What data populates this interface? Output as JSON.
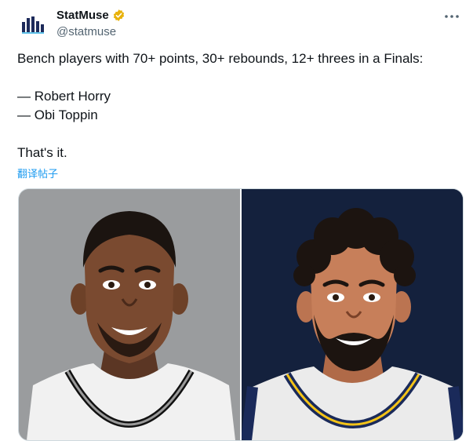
{
  "account": {
    "display_name": "StatMuse",
    "handle": "@statmuse",
    "avatar_icon": "statmuse-logo-icon",
    "verified_icon": "verified-badge-icon",
    "brand_color": "#1d2a5a",
    "verified_color": "#e8b20b"
  },
  "menu": {
    "icon": "more-horizontal-icon"
  },
  "tweet": {
    "line1": "Bench players with 70+ points, 30+ rebounds, 12+ threes in a Finals:",
    "line2": "— Robert Horry",
    "line3": "— Obi Toppin",
    "line4": "That's it.",
    "translate_label": "翻译帖子"
  },
  "media": {
    "left_player": {
      "background": "#9a9c9e",
      "jersey": "#f1f1f1",
      "trim": "#111111"
    },
    "right_player": {
      "background": "#14213d",
      "jersey": "#ebebeb",
      "trim": "#f3c318"
    }
  },
  "colors": {
    "link": "#1d9bf0",
    "secondary_text": "#536471"
  }
}
